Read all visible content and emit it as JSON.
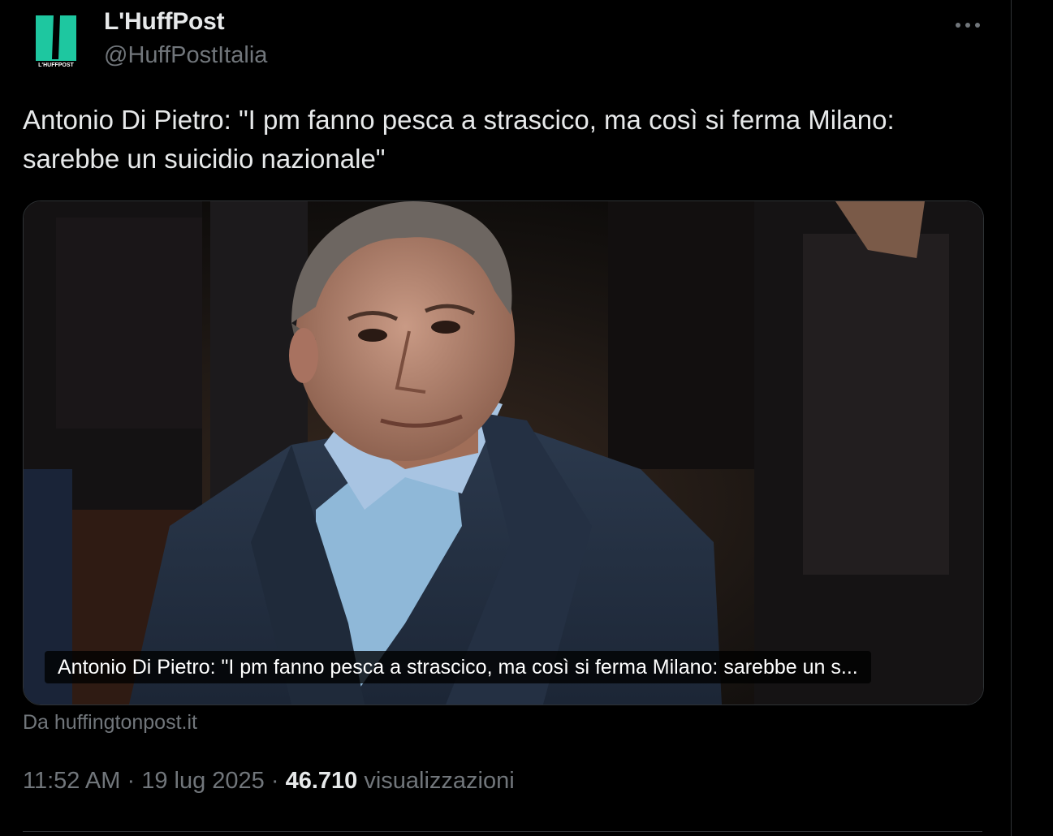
{
  "author": {
    "display_name": "L'HuffPost",
    "handle": "@HuffPostItalia",
    "avatar_label": "L'HUFFPOST",
    "brand_color": "#1ec7a0"
  },
  "tweet": {
    "text": "Antonio Di Pietro: \"I pm fanno pesca a strascico, ma così si ferma Milano: sarebbe un suicidio nazionale\"",
    "more_icon": "more-horizontal-icon"
  },
  "card": {
    "caption": "Antonio Di Pietro: \"I pm fanno pesca a strascico, ma così si ferma Milano: sarebbe un s...",
    "source": "Da huffingtonpost.it"
  },
  "meta": {
    "time": "11:52 AM",
    "separator": "·",
    "date": "19 lug 2025",
    "views_count": "46.710",
    "views_label": "visualizzazioni"
  },
  "colors": {
    "background": "#000000",
    "text_primary": "#e7e9ea",
    "text_secondary": "#71767b",
    "border": "#2f3336"
  }
}
